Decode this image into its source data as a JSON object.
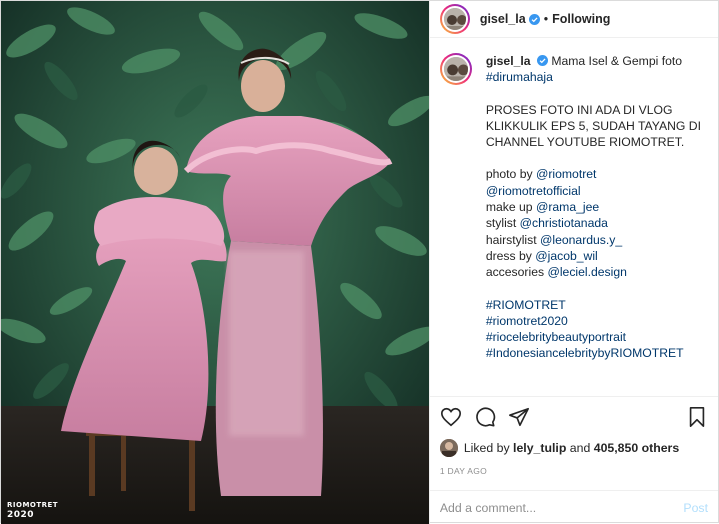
{
  "colors": {
    "link": "#00376b",
    "verified": "#3897f0",
    "post_disabled": "#b2dffc",
    "muted": "#8e8e8e"
  },
  "photo": {
    "watermark_brand": "RIOMOTRET",
    "watermark_year": "2020"
  },
  "header": {
    "username": "gisel_la",
    "separator": "•",
    "follow_state": "Following",
    "verified_icon": "verified-badge-icon"
  },
  "caption": {
    "username": "gisel_la",
    "intro": "Mama Isel & Gempi foto",
    "hashtag1": "#dirumahaja",
    "paragraph": "PROSES FOTO INI ADA DI VLOG KLIKKULIK EPS 5, SUDAH TAYANG DI CHANNEL YOUTUBE RIOMOTRET.",
    "credits": [
      {
        "label": "photo by",
        "handle": "@riomotret"
      },
      {
        "label": "",
        "handle": "@riomotretofficial"
      },
      {
        "label": "make up",
        "handle": "@rama_jee"
      },
      {
        "label": "stylist",
        "handle": "@christiotanada"
      },
      {
        "label": "hairstylist",
        "handle": "@leonardus.y_"
      },
      {
        "label": "dress by",
        "handle": "@jacob_wil"
      },
      {
        "label": "accesories",
        "handle": "@leciel.design"
      }
    ],
    "hashtags": [
      "#RIOMOTRET",
      "#riomotret2020",
      "#riocelebritybeautyportrait",
      "#IndonesiancelebritybyRIOMOTRET"
    ]
  },
  "actions": {
    "icons": [
      "heart-icon",
      "comment-icon",
      "share-icon",
      "bookmark-icon"
    ]
  },
  "likes": {
    "prefix": "Liked by",
    "user": "lely_tulip",
    "joiner": "and",
    "count": "405,850 others"
  },
  "timestamp": "1 DAY AGO",
  "comment_box": {
    "placeholder": "Add a comment...",
    "post_label": "Post"
  }
}
